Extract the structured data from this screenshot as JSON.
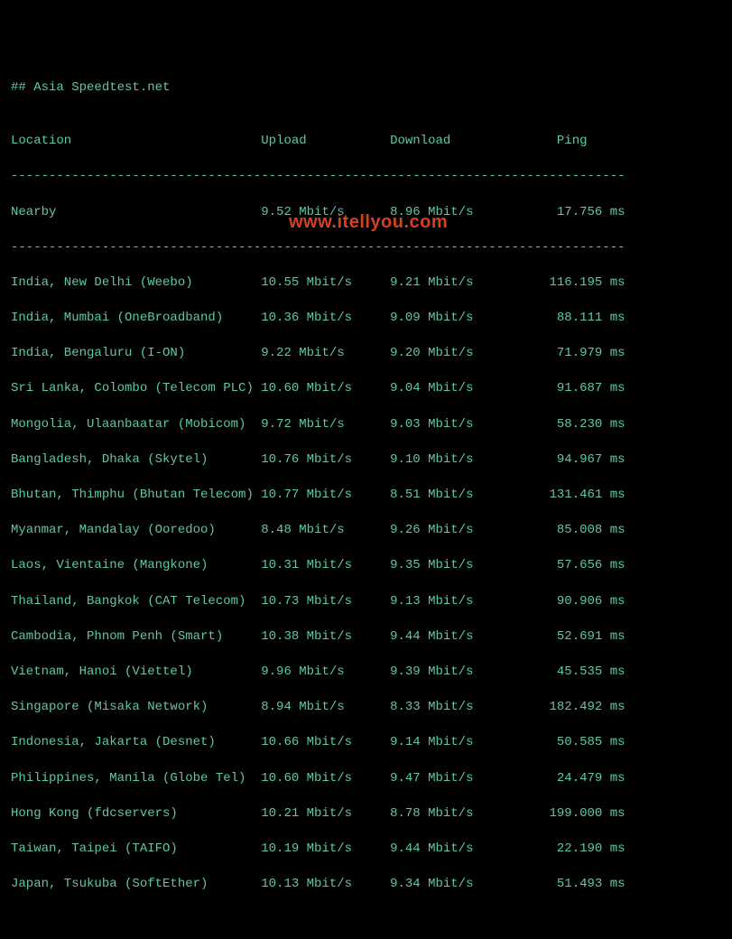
{
  "title": "## Asia Speedtest.net",
  "blank": "",
  "headers": {
    "location": "Location",
    "upload": "Upload",
    "download": "Download",
    "ping": "Ping"
  },
  "divider": "---------------------------------------------------------------------------------",
  "nearby": {
    "location": "Nearby",
    "upload": "9.52 Mbit/s",
    "download": "8.96 Mbit/s",
    "ping": "17.756 ms"
  },
  "rows": [
    {
      "location": "India, New Delhi (Weebo)",
      "upload": "10.55 Mbit/s",
      "download": "9.21 Mbit/s",
      "ping": "116.195 ms"
    },
    {
      "location": "India, Mumbai (OneBroadband)",
      "upload": "10.36 Mbit/s",
      "download": "9.09 Mbit/s",
      "ping": "88.111 ms"
    },
    {
      "location": "India, Bengaluru (I-ON)",
      "upload": "9.22 Mbit/s",
      "download": "9.20 Mbit/s",
      "ping": "71.979 ms"
    },
    {
      "location": "Sri Lanka, Colombo (Telecom PLC)",
      "upload": "10.60 Mbit/s",
      "download": "9.04 Mbit/s",
      "ping": "91.687 ms"
    },
    {
      "location": "Mongolia, Ulaanbaatar (Mobicom)",
      "upload": "9.72 Mbit/s",
      "download": "9.03 Mbit/s",
      "ping": "58.230 ms"
    },
    {
      "location": "Bangladesh, Dhaka (Skytel)",
      "upload": "10.76 Mbit/s",
      "download": "9.10 Mbit/s",
      "ping": "94.967 ms"
    },
    {
      "location": "Bhutan, Thimphu (Bhutan Telecom)",
      "upload": "10.77 Mbit/s",
      "download": "8.51 Mbit/s",
      "ping": "131.461 ms"
    },
    {
      "location": "Myanmar, Mandalay (Ooredoo)",
      "upload": "8.48 Mbit/s",
      "download": "9.26 Mbit/s",
      "ping": "85.008 ms"
    },
    {
      "location": "Laos, Vientaine (Mangkone)",
      "upload": "10.31 Mbit/s",
      "download": "9.35 Mbit/s",
      "ping": "57.656 ms"
    },
    {
      "location": "Thailand, Bangkok (CAT Telecom)",
      "upload": "10.73 Mbit/s",
      "download": "9.13 Mbit/s",
      "ping": "90.906 ms"
    },
    {
      "location": "Cambodia, Phnom Penh (Smart)",
      "upload": "10.38 Mbit/s",
      "download": "9.44 Mbit/s",
      "ping": "52.691 ms"
    },
    {
      "location": "Vietnam, Hanoi (Viettel)",
      "upload": "9.96 Mbit/s",
      "download": "9.39 Mbit/s",
      "ping": "45.535 ms"
    },
    {
      "location": "Singapore (Misaka Network)",
      "upload": "8.94 Mbit/s",
      "download": "8.33 Mbit/s",
      "ping": "182.492 ms"
    },
    {
      "location": "Indonesia, Jakarta (Desnet)",
      "upload": "10.66 Mbit/s",
      "download": "9.14 Mbit/s",
      "ping": "50.585 ms"
    },
    {
      "location": "Philippines, Manila (Globe Tel)",
      "upload": "10.60 Mbit/s",
      "download": "9.47 Mbit/s",
      "ping": "24.479 ms"
    },
    {
      "location": "Hong Kong (fdcservers)",
      "upload": "10.21 Mbit/s",
      "download": "8.78 Mbit/s",
      "ping": "199.000 ms"
    },
    {
      "location": "Taiwan, Taipei (TAIFO)",
      "upload": "10.19 Mbit/s",
      "download": "9.44 Mbit/s",
      "ping": "22.190 ms"
    },
    {
      "location": "Japan, Tsukuba (SoftEther)",
      "upload": "10.13 Mbit/s",
      "download": "9.34 Mbit/s",
      "ping": "51.493 ms"
    }
  ],
  "watermark": "www.itellyou.com"
}
